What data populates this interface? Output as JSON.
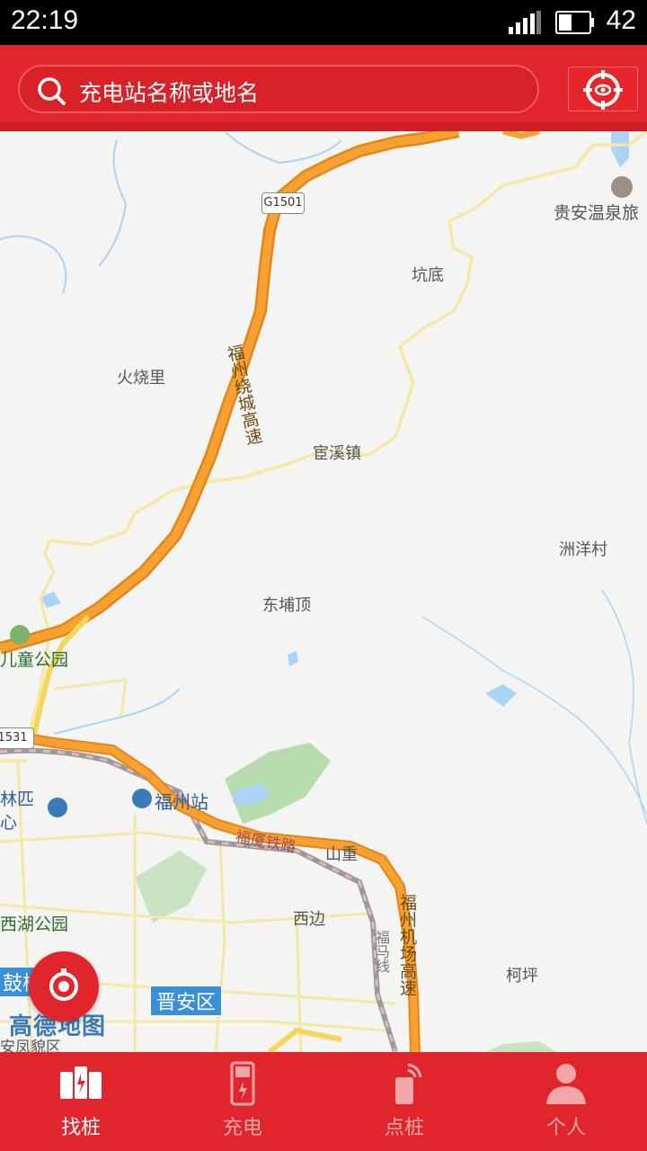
{
  "status_bar": {
    "time": "22:19",
    "battery": "42"
  },
  "search": {
    "placeholder": "充电站名称或地名"
  },
  "map": {
    "labels": {
      "guian": "贵安温泉旅",
      "kengdi": "坑底",
      "huoshaoli": "火烧里",
      "huanxizhen": "宦溪镇",
      "zhouyangcun": "洲洋村",
      "dongpuding": "东埔顶",
      "ertong": "儿童公园",
      "fuzhouzhan": "福州站",
      "linpi": "林匹",
      "xin": "心",
      "shanzhong": "山重",
      "xihu": "西湖公园",
      "xibian": "西边",
      "keping": "柯坪",
      "gu": "鼓楼",
      "anfeng": "安凤貌区"
    },
    "roads": {
      "ring": "福州绕城高速",
      "airport": "福州机场高速",
      "rail": "福厦铁路",
      "fuma": "福马线"
    },
    "shields": {
      "g1501": "G1501",
      "g1531": "1531"
    },
    "district": "晋安区",
    "logo": "高德地图"
  },
  "tabs": [
    {
      "label": "找桩",
      "icon": "find-pile-icon",
      "active": true
    },
    {
      "label": "充电",
      "icon": "charging-icon",
      "active": false
    },
    {
      "label": "点桩",
      "icon": "point-pile-icon",
      "active": false
    },
    {
      "label": "个人",
      "icon": "person-icon",
      "active": false
    }
  ],
  "colors": {
    "brand": "#e0262c",
    "highway": "#f39a1e",
    "minor_road": "#f5e39a",
    "water": "#a9d4f5",
    "park": "#b6dcae"
  }
}
